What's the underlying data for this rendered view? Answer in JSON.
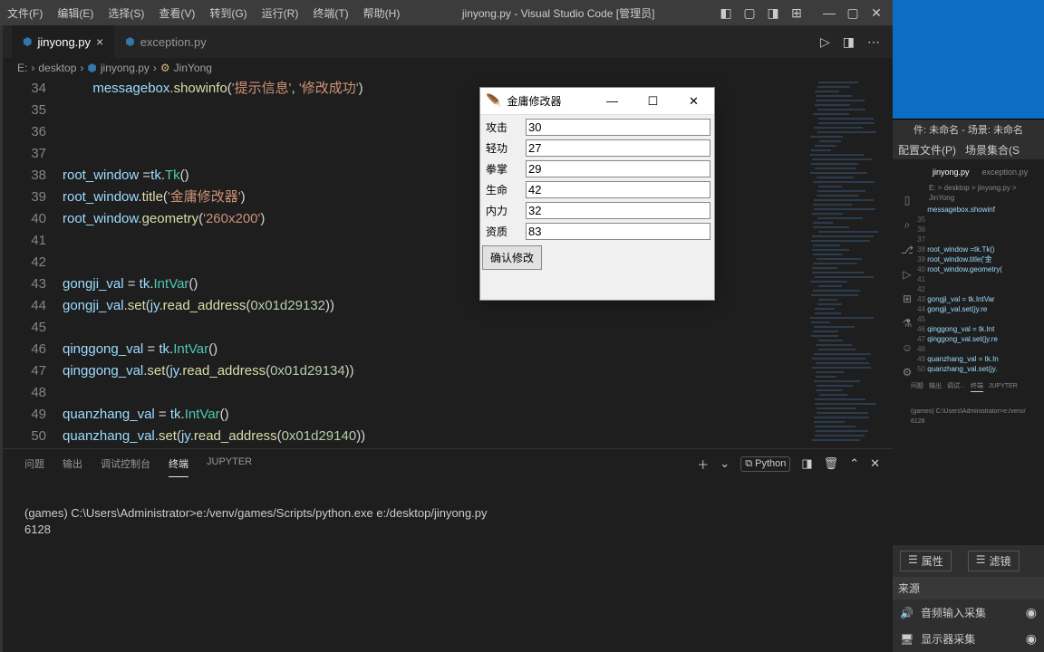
{
  "vscode": {
    "menu": [
      "文件(F)",
      "编辑(E)",
      "选择(S)",
      "查看(V)",
      "转到(G)",
      "运行(R)",
      "终端(T)",
      "帮助(H)"
    ],
    "title": "jinyong.py - Visual Studio Code [管理员]",
    "tabs": [
      {
        "icon": "⬢",
        "name": "jinyong.py",
        "active": true
      },
      {
        "icon": "⬢",
        "name": "exception.py",
        "active": false
      }
    ],
    "breadcrumb": {
      "a": "E:",
      "b": "desktop",
      "c": "jinyong.py",
      "d": "JinYong"
    },
    "lines": [
      {
        "n": 34,
        "html": "<span class='s-var'>messagebox</span>.<span class='s-fn'>showinfo</span>(<span class='s-str'>'提示信息'</span>, <span class='s-str'>'修改成功'</span>)"
      },
      {
        "n": 35,
        "html": ""
      },
      {
        "n": 36,
        "html": ""
      },
      {
        "n": 37,
        "html": ""
      },
      {
        "n": 38,
        "html": "<span class='s-var'>root_window</span> =<span class='s-var'>tk</span>.<span class='s-cls'>Tk</span>()"
      },
      {
        "n": 39,
        "html": "<span class='s-var'>root_window</span>.<span class='s-fn'>title</span>(<span class='s-str'>'金庸修改器'</span>)"
      },
      {
        "n": 40,
        "html": "<span class='s-var'>root_window</span>.<span class='s-fn'>geometry</span>(<span class='s-str'>'260x200'</span>)"
      },
      {
        "n": 41,
        "html": ""
      },
      {
        "n": 42,
        "html": ""
      },
      {
        "n": 43,
        "html": "<span class='s-var'>gongji_val</span> = <span class='s-var'>tk</span>.<span class='s-cls'>IntVar</span>()"
      },
      {
        "n": 44,
        "html": "<span class='s-var'>gongji_val</span>.<span class='s-fn'>set</span>(<span class='s-var'>jy</span>.<span class='s-fn'>read_address</span>(<span class='s-num'>0x01d29132</span>))"
      },
      {
        "n": 45,
        "html": ""
      },
      {
        "n": 46,
        "html": "<span class='s-var'>qinggong_val</span> = <span class='s-var'>tk</span>.<span class='s-cls'>IntVar</span>()"
      },
      {
        "n": 47,
        "html": "<span class='s-var'>qinggong_val</span>.<span class='s-fn'>set</span>(<span class='s-var'>jy</span>.<span class='s-fn'>read_address</span>(<span class='s-num'>0x01d29134</span>))"
      },
      {
        "n": 48,
        "html": ""
      },
      {
        "n": 49,
        "html": "<span class='s-var'>quanzhang_val</span> = <span class='s-var'>tk</span>.<span class='s-cls'>IntVar</span>()"
      },
      {
        "n": 50,
        "html": "<span class='s-var'>quanzhang_val</span>.<span class='s-fn'>set</span>(<span class='s-var'>jy</span>.<span class='s-fn'>read_address</span>(<span class='s-num'>0x01d29140</span>))"
      }
    ],
    "panel": {
      "tabs": [
        "问题",
        "输出",
        "调试控制台",
        "终端",
        "JUPYTER"
      ],
      "active": "终端",
      "right_label": "Python",
      "term1": "(games) C:\\Users\\Administrator>e:/venv/games/Scripts/python.exe e:/desktop/jinyong.py",
      "term2": "6128"
    }
  },
  "tk": {
    "title": "金庸修改器",
    "rows": [
      {
        "label": "攻击",
        "value": "30"
      },
      {
        "label": "轻功",
        "value": "27"
      },
      {
        "label": "拳掌",
        "value": "29"
      },
      {
        "label": "生命",
        "value": "42"
      },
      {
        "label": "内力",
        "value": "32"
      },
      {
        "label": "资质",
        "value": "83"
      }
    ],
    "button": "确认修改"
  },
  "obs": {
    "header": "件: 未命名 - 场景: 未命名",
    "menu": [
      "配置文件(P)",
      "场景集合(S"
    ],
    "mini_tabs": [
      "jinyong.py",
      "exception.py"
    ],
    "mini_bc": "E: > desktop > jinyong.py > JinYong",
    "mini_lines": [
      {
        "n": "",
        "t": "messagebox.showinf"
      },
      {
        "n": "35",
        "t": ""
      },
      {
        "n": "36",
        "t": ""
      },
      {
        "n": "37",
        "t": ""
      },
      {
        "n": "38",
        "t": "root_window =tk.Tk()"
      },
      {
        "n": "39",
        "t": "root_window.title('金"
      },
      {
        "n": "40",
        "t": "root_window.geometry("
      },
      {
        "n": "41",
        "t": ""
      },
      {
        "n": "42",
        "t": ""
      },
      {
        "n": "43",
        "t": "gongji_val = tk.IntVar"
      },
      {
        "n": "44",
        "t": "gongji_val.set(jy.re"
      },
      {
        "n": "45",
        "t": ""
      },
      {
        "n": "46",
        "t": "qinggong_val = tk.Int"
      },
      {
        "n": "47",
        "t": "qinggong_val.set(jy.re"
      },
      {
        "n": "48",
        "t": ""
      },
      {
        "n": "49",
        "t": "quanzhang_val = tk.In"
      },
      {
        "n": "50",
        "t": "quanzhang_val.set(jy."
      }
    ],
    "mini_panel": [
      "问题",
      "输出",
      "调试...",
      "终端",
      "JUPYTER"
    ],
    "mini_term1": "(games) C:\\Users\\Administrator>e:/venv/",
    "mini_term2": "6128",
    "props": {
      "p1": "属性",
      "p2": "滤镜"
    },
    "src_head": "来源",
    "sources": [
      {
        "icon": "🔊",
        "name": "音频输入采集"
      },
      {
        "icon": "🖥",
        "name": "显示器采集"
      }
    ]
  }
}
